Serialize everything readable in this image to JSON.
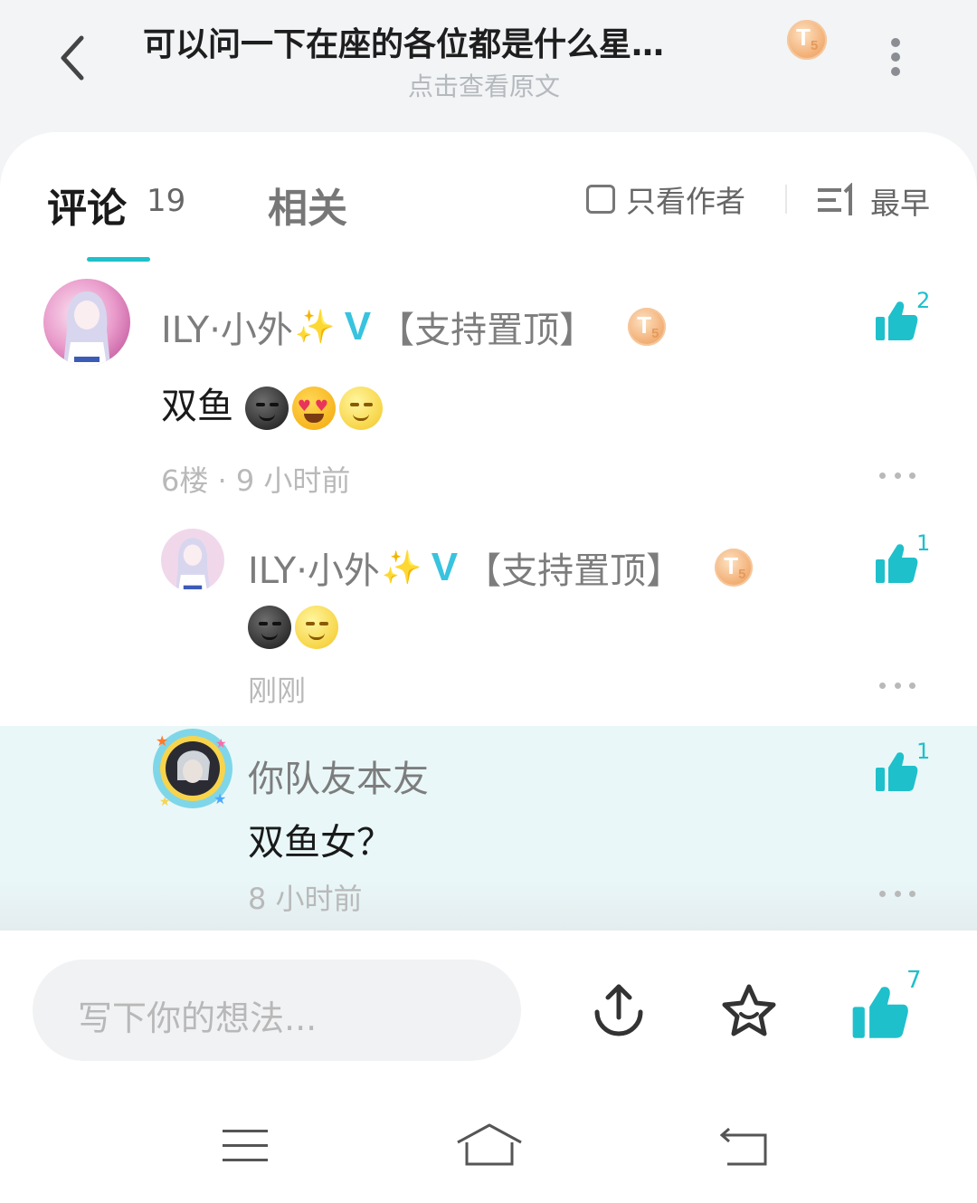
{
  "header": {
    "title": "可以问一下在座的各位都是什么星…",
    "subtitle": "点击查看原文",
    "coin_t": "T",
    "coin_s": "5"
  },
  "tabs": {
    "comments_label": "评论",
    "comments_count": "19",
    "related_label": "相关",
    "author_only_label": "只看作者",
    "sort_label": "最早"
  },
  "comments": [
    {
      "user": "ILY·小外",
      "sparkle": "✨",
      "verified": "V",
      "tag": "【支持置顶】",
      "content_text": "双鱼",
      "floor_time": "6楼 · 9 小时前",
      "likes": "2"
    },
    {
      "user": "ILY·小外",
      "sparkle": "✨",
      "verified": "V",
      "tag": "【支持置顶】",
      "content_text": "",
      "floor_time": "刚刚",
      "likes": "1"
    },
    {
      "user": "你队友本友",
      "content_text": "双鱼女？",
      "floor_time": "8 小时前",
      "likes": "1"
    }
  ],
  "bottom": {
    "input_placeholder": "写下你的想法...",
    "like_count": "7"
  },
  "colors": {
    "accent": "#1ec0cb",
    "verified": "#38c3df",
    "highlight_bg": "#e9f7f8"
  }
}
